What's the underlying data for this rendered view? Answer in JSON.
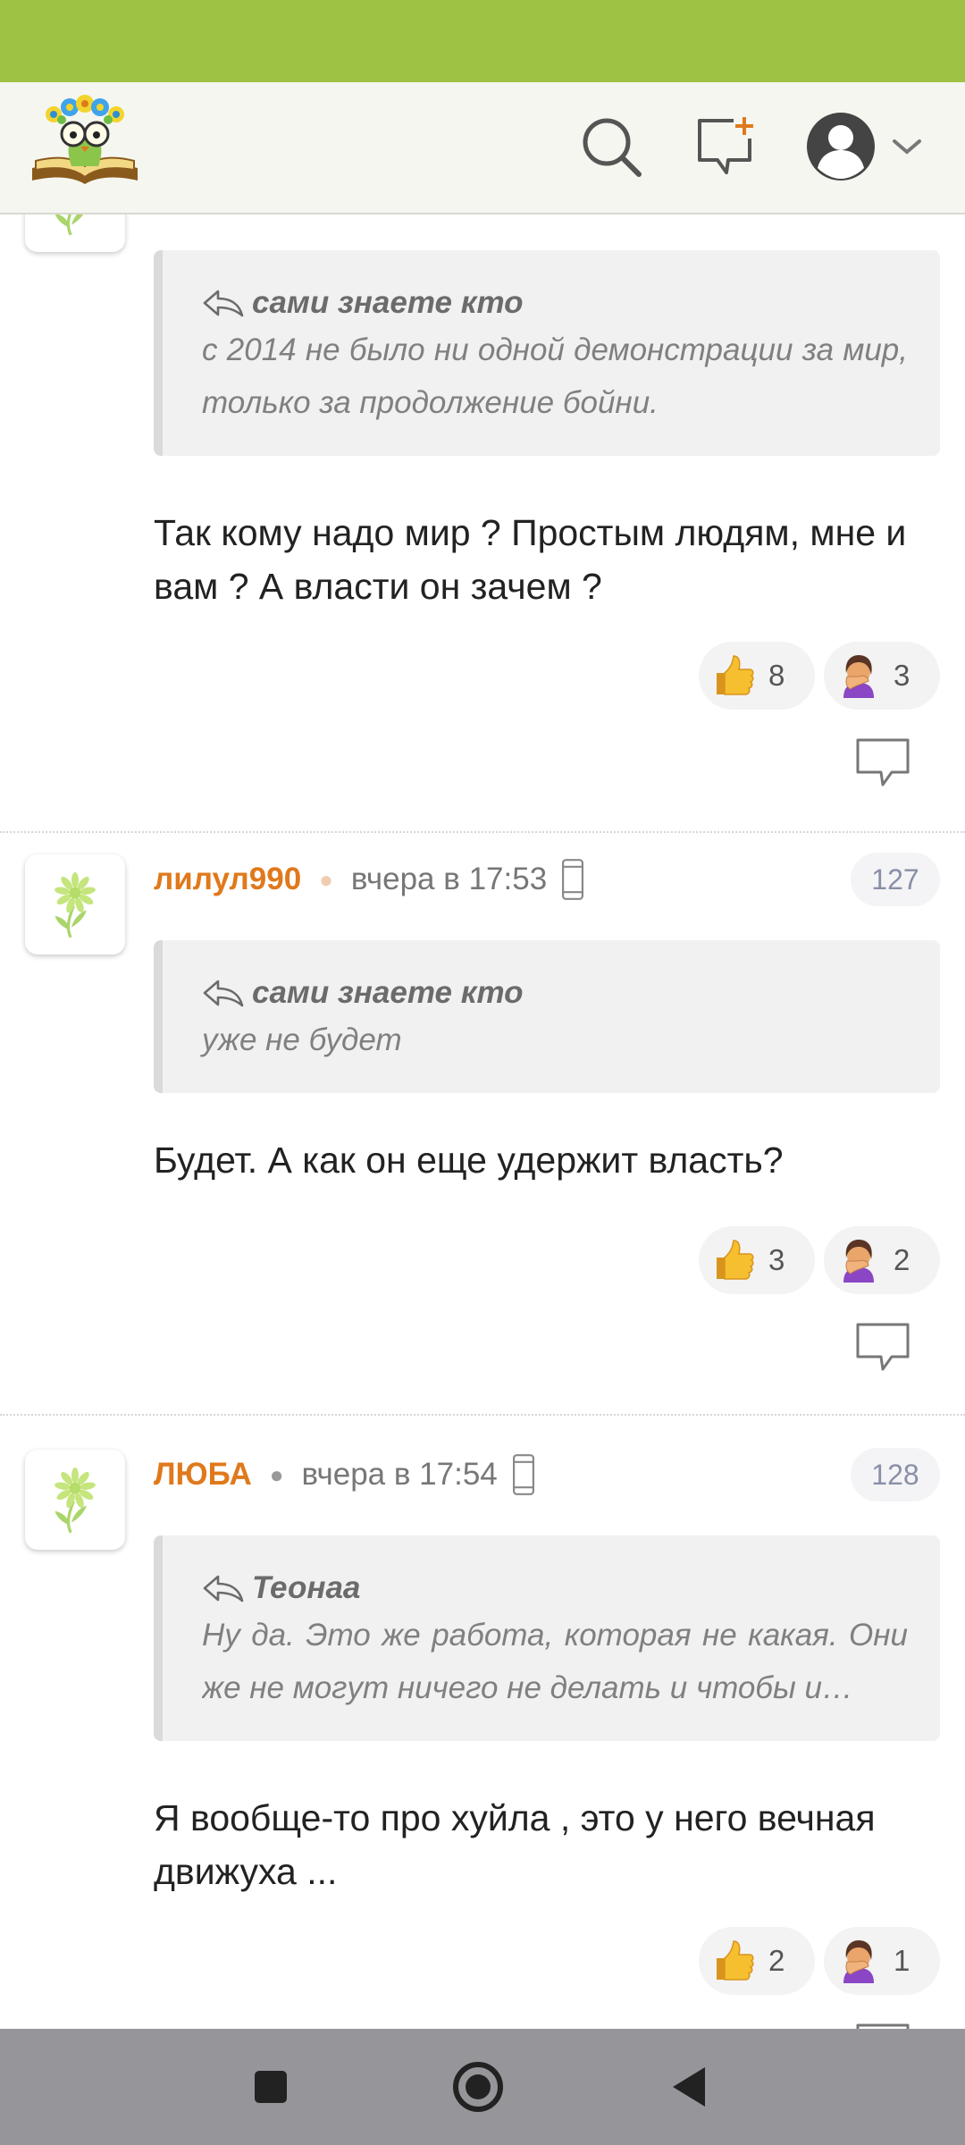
{
  "colors": {
    "status_bar": "#9ec244",
    "author": "#e0791c",
    "nav_bar": "#96969a"
  },
  "header": {
    "logo_icon": "book-flower-owl-logo",
    "search_icon": "search-icon",
    "compose_icon": "new-comment-icon",
    "profile_icon": "profile-avatar-icon"
  },
  "comments": [
    {
      "quote": {
        "author": "сами знаете кто",
        "text": "с 2014 не было ни одной демонстрации за мир, только за продолжение бойни."
      },
      "text": "Так кому надо мир ? Простым людям, мне и вам ? А власти он зачем ?",
      "reactions": [
        {
          "icon": "thumbs-up-icon",
          "count": "8"
        },
        {
          "icon": "facepalm-icon",
          "count": "3"
        }
      ]
    },
    {
      "author": "лилул990",
      "time": "вчера в 17:53",
      "number": "127",
      "quote": {
        "author": "сами знаете кто",
        "text": "уже не будет"
      },
      "text": "Будет. А как он еще удержит власть?",
      "reactions": [
        {
          "icon": "thumbs-up-icon",
          "count": "3"
        },
        {
          "icon": "facepalm-icon",
          "count": "2"
        }
      ]
    },
    {
      "author": "ЛЮБА",
      "time": "вчера в 17:54",
      "number": "128",
      "quote": {
        "author": "Теонаа",
        "text": "Ну да. Это же работа, которая не какая. Они же не могут ничего не делать и чтобы и…"
      },
      "text": "Я вообще-то про хуйла , это у него вечная движуха ...",
      "reactions": [
        {
          "icon": "thumbs-up-icon",
          "count": "2"
        },
        {
          "icon": "facepalm-icon",
          "count": "1"
        }
      ]
    }
  ],
  "navbar": {
    "recents_icon": "square-recents-icon",
    "home_icon": "circle-home-icon",
    "back_icon": "triangle-back-icon"
  }
}
